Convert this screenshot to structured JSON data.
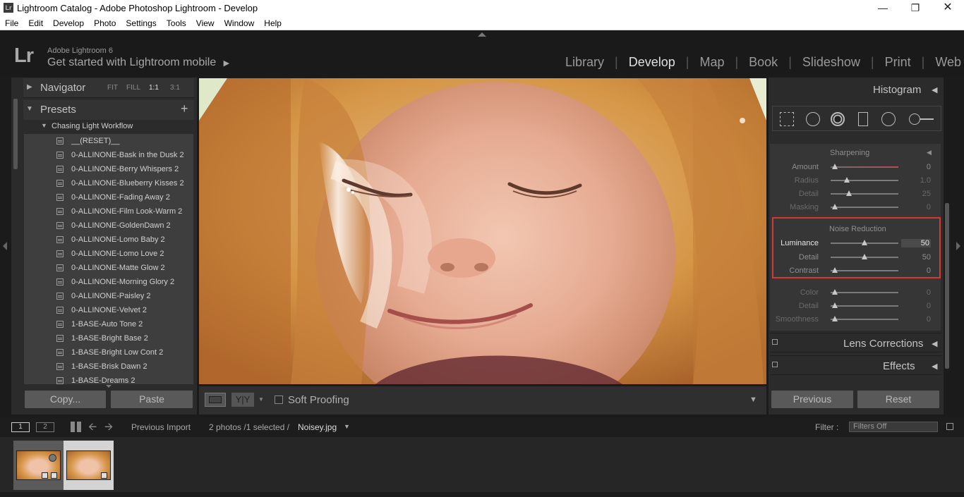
{
  "window": {
    "title": "Lightroom Catalog - Adobe Photoshop Lightroom - Develop",
    "icon_text": "Lr"
  },
  "menu": [
    "File",
    "Edit",
    "Develop",
    "Photo",
    "Settings",
    "Tools",
    "View",
    "Window",
    "Help"
  ],
  "identity": {
    "logo": "Lr",
    "version": "Adobe Lightroom 6",
    "mobile": "Get started with Lightroom mobile"
  },
  "modules": [
    {
      "label": "Library",
      "active": false
    },
    {
      "label": "Develop",
      "active": true
    },
    {
      "label": "Map",
      "active": false
    },
    {
      "label": "Book",
      "active": false
    },
    {
      "label": "Slideshow",
      "active": false
    },
    {
      "label": "Print",
      "active": false
    },
    {
      "label": "Web",
      "active": false
    }
  ],
  "navigator": {
    "title": "Navigator",
    "zooms": [
      "FIT",
      "FILL",
      "1:1",
      "3:1"
    ],
    "active_zoom": "1:1"
  },
  "presets": {
    "title": "Presets",
    "add_symbol": "+",
    "folder": "Chasing Light Workflow",
    "items": [
      "__(RESET)__",
      "0-ALLINONE-Bask in the Dusk 2",
      "0-ALLINONE-Berry Whispers 2",
      "0-ALLINONE-Blueberry Kisses 2",
      "0-ALLINONE-Fading Away 2",
      "0-ALLINONE-Film Look-Warm 2",
      "0-ALLINONE-GoldenDawn 2",
      "0-ALLINONE-Lomo Baby 2",
      "0-ALLINONE-Lomo Love 2",
      "0-ALLINONE-Matte Glow 2",
      "0-ALLINONE-Morning Glory 2",
      "0-ALLINONE-Paisley 2",
      "0-ALLINONE-Velvet 2",
      "1-BASE-Auto Tone 2",
      "1-BASE-Bright Base 2",
      "1-BASE-Bright Low Cont 2",
      "1-BASE-Brisk Dawn 2",
      "1-BASE-Dreams 2"
    ]
  },
  "left_buttons": {
    "copy": "Copy...",
    "paste": "Paste"
  },
  "toolbar": {
    "soft_proofing": "Soft Proofing",
    "yy": "Y|Y"
  },
  "histogram": {
    "title": "Histogram"
  },
  "sharpening": {
    "title": "Sharpening",
    "sliders": [
      {
        "label": "Amount",
        "value": "0",
        "pos": 0.0
      },
      {
        "label": "Radius",
        "value": "1.0",
        "pos": 0.22
      },
      {
        "label": "Detail",
        "value": "25",
        "pos": 0.25
      },
      {
        "label": "Masking",
        "value": "0",
        "pos": 0.0
      }
    ]
  },
  "noise_reduction": {
    "title": "Noise Reduction",
    "sliders": [
      {
        "label": "Luminance",
        "value": "50",
        "pos": 0.5
      },
      {
        "label": "Detail",
        "value": "50",
        "pos": 0.5
      },
      {
        "label": "Contrast",
        "value": "0",
        "pos": 0.0
      }
    ],
    "color_sliders": [
      {
        "label": "Color",
        "value": "0",
        "pos": 0.0
      },
      {
        "label": "Detail",
        "value": "0",
        "pos": 0.0
      },
      {
        "label": "Smoothness",
        "value": "0",
        "pos": 0.0
      }
    ]
  },
  "panels": {
    "lens": "Lens Corrections",
    "effects": "Effects"
  },
  "right_buttons": {
    "previous": "Previous",
    "reset": "Reset"
  },
  "filmstrip": {
    "screen1": "1",
    "screen2": "2",
    "source": "Previous Import",
    "info": "2 photos /1 selected /",
    "filename": "Noisey.jpg",
    "filter_label": "Filter :",
    "filter_value": "Filters Off"
  }
}
